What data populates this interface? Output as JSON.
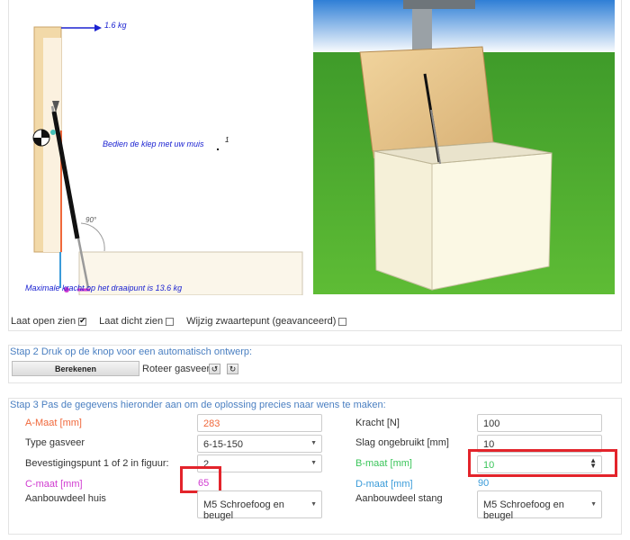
{
  "diagram": {
    "force_label": "1.6 kg",
    "instruction": "Bedien de klep met uw muis",
    "point_number": "1",
    "angle": "90°",
    "max_force": "Maximale kracht op het draaipunt is 13.6 kg"
  },
  "options": {
    "open_label": "Laat open zien",
    "open_checked": true,
    "closed_label": "Laat dicht zien",
    "closed_checked": false,
    "cog_label": "Wijzig zwaartepunt (geavanceerd)",
    "cog_checked": false
  },
  "step2": {
    "title": "Stap 2 Druk op de knop voor een automatisch ontwerp:",
    "calc_button": "Berekenen",
    "rotate_label": "Roteer gasveer",
    "rotate_left_icon": "↺",
    "rotate_right_icon": "↻"
  },
  "step3": {
    "title": "Stap 3 Pas de gegevens hieronder aan om de oplossing precies naar wens te maken:",
    "a_label": "A-Maat [mm]",
    "a_value": "283",
    "type_label": "Type gasveer",
    "type_value": "6-15-150",
    "mount_label": "Bevestigingspunt 1 of 2 in figuur:",
    "mount_value": "2",
    "c_label": "C-maat [mm]",
    "c_value": "65",
    "house_label": "Aanbouwdeel huis",
    "house_value": "M5 Schroefoog en beugel",
    "force_label": "Kracht [N]",
    "force_value": "100",
    "stroke_label": "Slag ongebruikt [mm]",
    "stroke_value": "10",
    "b_label": "B-maat [mm]",
    "b_value": "10",
    "d_label": "D-maat [mm]",
    "d_value": "90",
    "rod_label": "Aanbouwdeel stang",
    "rod_value": "M5 Schroefoog en beugel"
  },
  "colors": {
    "a": "#f0683b",
    "b": "#3bc55a",
    "c": "#d03bd0",
    "d": "#3a9bd9",
    "step_title": "#4a7fc1",
    "highlight": "#e3242b"
  }
}
